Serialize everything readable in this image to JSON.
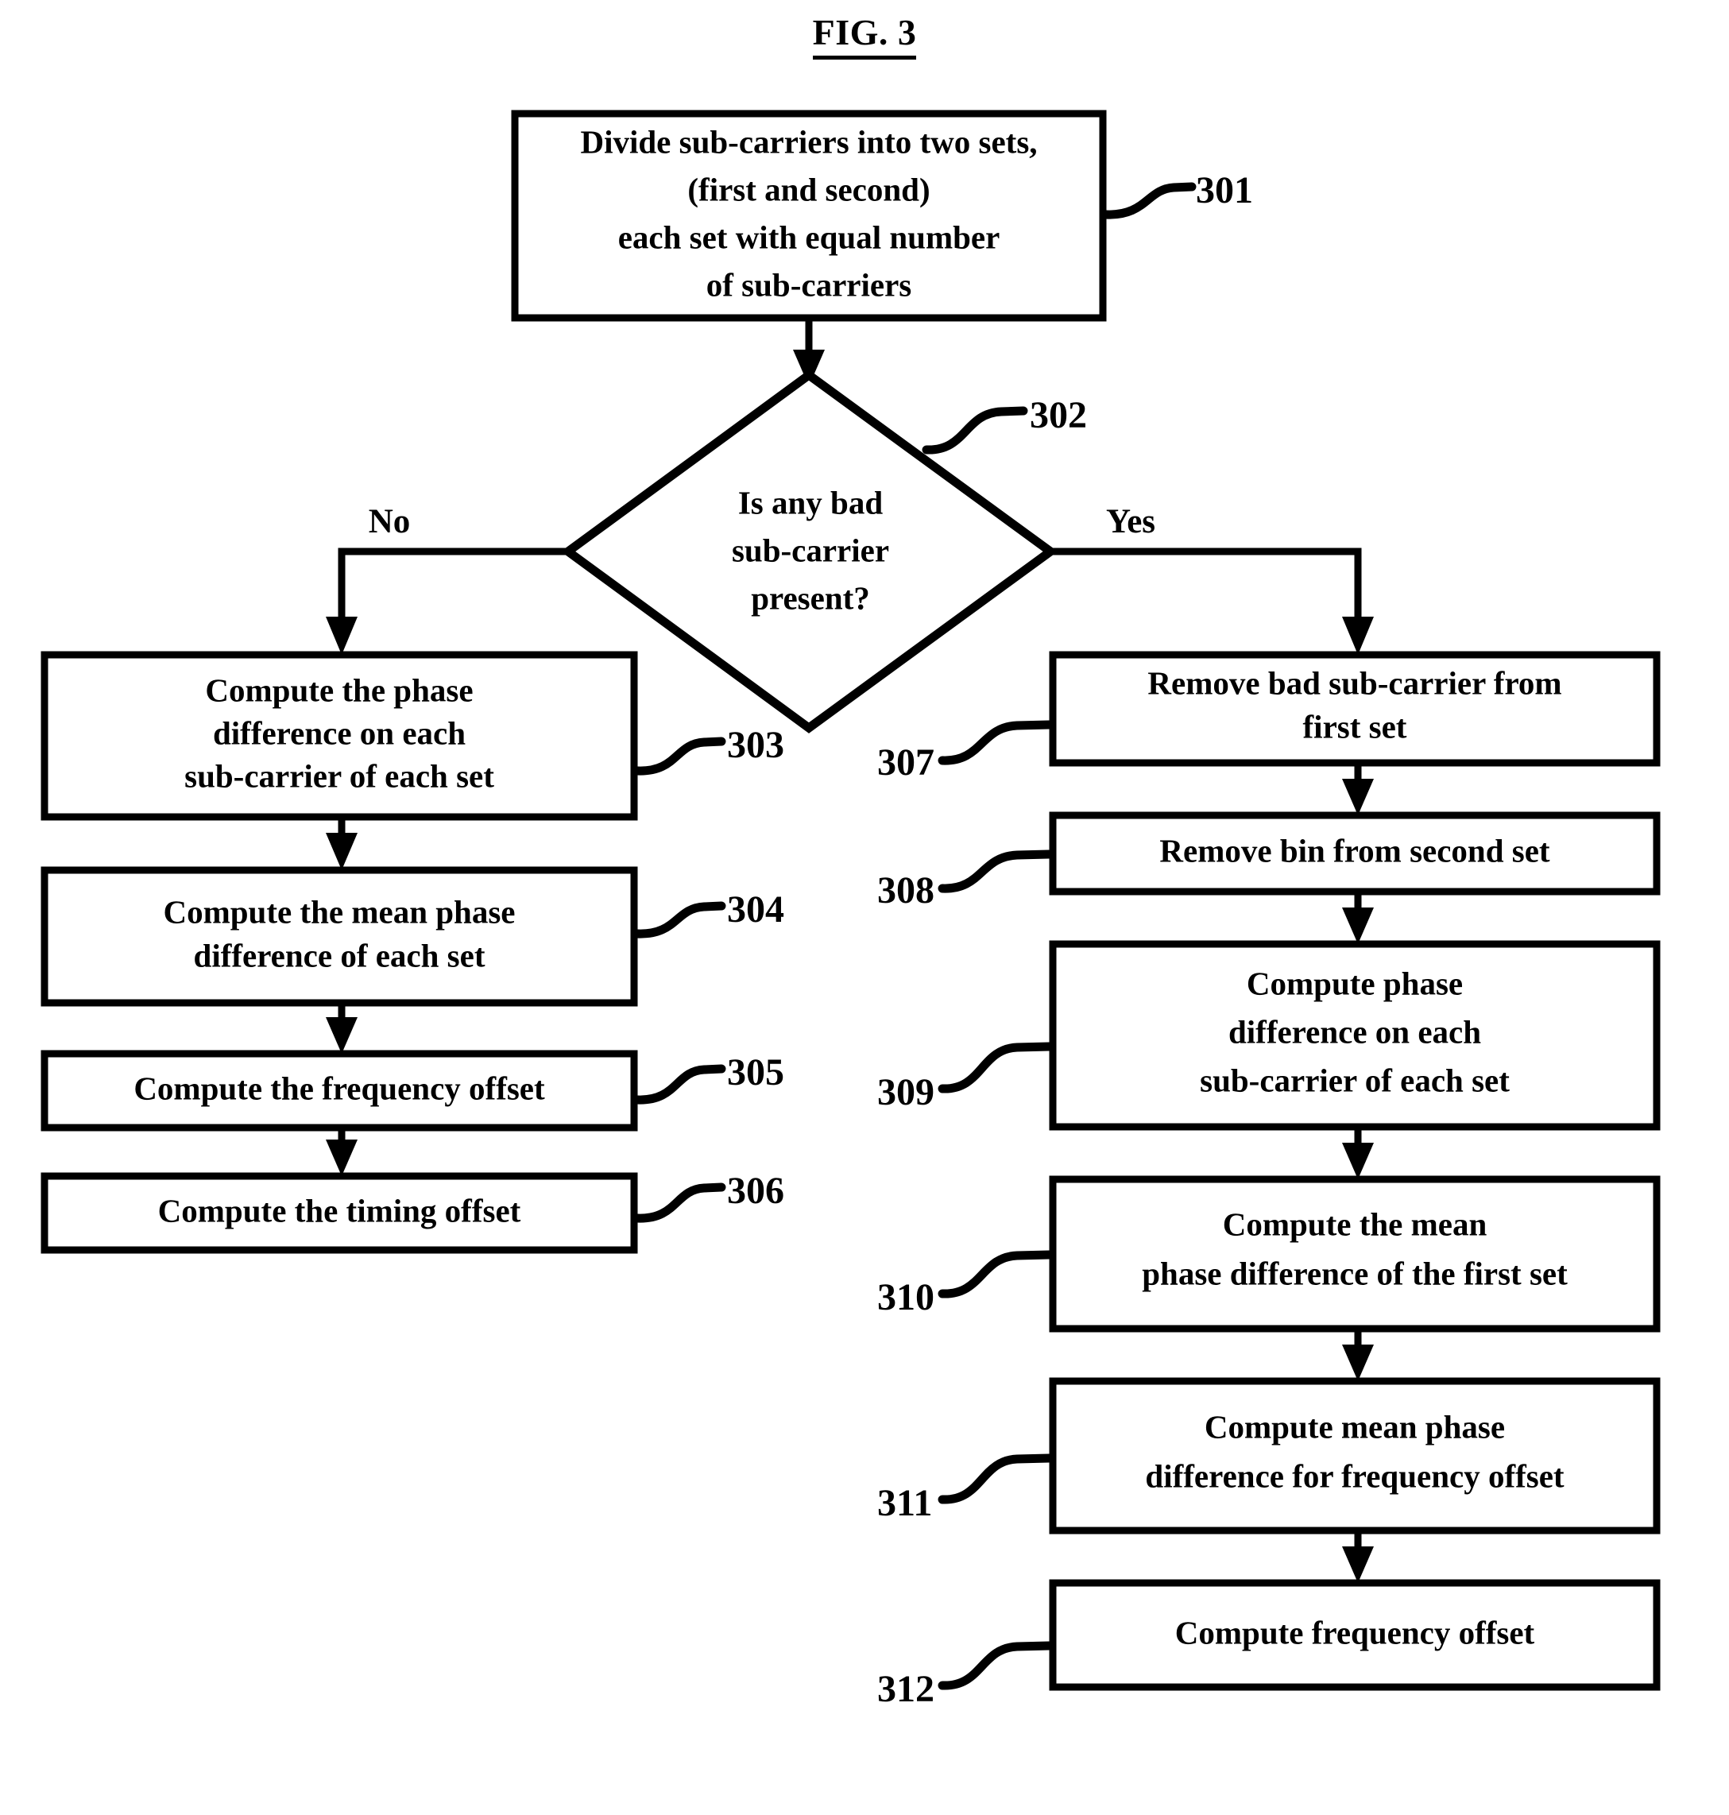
{
  "figure": {
    "title": "FIG. 3",
    "type": "flowchart",
    "branch_labels": {
      "no": "No",
      "yes": "Yes"
    }
  },
  "nodes": [
    {
      "ref": "301",
      "shape": "process",
      "lines": [
        "Divide sub-carriers into two sets,",
        "(first and second)",
        "each set with equal number",
        "of sub-carriers"
      ]
    },
    {
      "ref": "302",
      "shape": "decision",
      "lines": [
        "Is any bad",
        "sub-carrier",
        "present?"
      ]
    },
    {
      "ref": "303",
      "shape": "process",
      "lines": [
        "Compute the phase",
        "difference on each",
        "sub-carrier of each set"
      ]
    },
    {
      "ref": "304",
      "shape": "process",
      "lines": [
        "Compute the mean phase",
        "difference of each set"
      ]
    },
    {
      "ref": "305",
      "shape": "process",
      "lines": [
        "Compute the frequency offset"
      ]
    },
    {
      "ref": "306",
      "shape": "process",
      "lines": [
        "Compute the timing offset"
      ]
    },
    {
      "ref": "307",
      "shape": "process",
      "lines": [
        "Remove bad sub-carrier from",
        "first set"
      ]
    },
    {
      "ref": "308",
      "shape": "process",
      "lines": [
        "Remove bin from second set"
      ]
    },
    {
      "ref": "309",
      "shape": "process",
      "lines": [
        "Compute phase",
        "difference on each",
        "sub-carrier of each set"
      ]
    },
    {
      "ref": "310",
      "shape": "process",
      "lines": [
        "Compute the mean",
        "phase difference of the first set"
      ]
    },
    {
      "ref": "311",
      "shape": "process",
      "lines": [
        "Compute mean phase",
        "difference for frequency offset"
      ]
    },
    {
      "ref": "312",
      "shape": "process",
      "lines": [
        "Compute frequency offset"
      ]
    }
  ]
}
